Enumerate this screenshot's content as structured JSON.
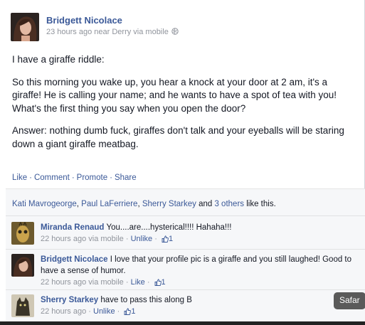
{
  "post": {
    "author": "Bridgett Nicolace",
    "meta": "23 hours ago near Derry via mobile",
    "paragraphs": [
      "I have a giraffe riddle:",
      "So this morning you wake up, you hear a knock at your door at 2 am, it's a giraffe! He is calling your name; and he wants to have a spot of tea with you! What's the first thing you say when you open the door?",
      "Answer: nothing dumb fuck, giraffes don't talk and your eyeballs will be staring down a giant giraffe meatbag."
    ],
    "actions": {
      "like": "Like",
      "comment": "Comment",
      "promote": "Promote",
      "share": "Share",
      "separator": "·"
    }
  },
  "likes": {
    "names": [
      "Kati Mavrogeorge",
      "Paul LaFerriere",
      "Sherry Starkey"
    ],
    "comma": ", ",
    "and": " and ",
    "others": "3 others",
    "suffix": " like this."
  },
  "comments": [
    {
      "name": "Miranda Renaud",
      "text": "You....are....hysterical!!!! Hahaha!!!",
      "time": "22 hours ago via mobile",
      "action": "Unlike",
      "likes": "1",
      "avatar_color": "#c9a34c"
    },
    {
      "name": "Bridgett Nicolace",
      "text": "I love that your profile pic is a giraffe and you still laughed! Good to have a sense of humor.",
      "time": "22 hours ago via mobile",
      "action": "Like",
      "likes": "1",
      "avatar_color": "#5b3a28"
    },
    {
      "name": "Sherry Starkey",
      "text": "have to pass this along B",
      "time": "22 hours ago",
      "action": "Unlike",
      "likes": "1",
      "avatar_color": "#8b7a55"
    }
  ],
  "tooltip": "Safar",
  "icons": {
    "globe": "globe-icon",
    "thumb": "thumbs-up-icon"
  },
  "colors": {
    "link": "#3b5998",
    "meta": "#90949c",
    "feedback_bg": "#f6f7f9"
  }
}
